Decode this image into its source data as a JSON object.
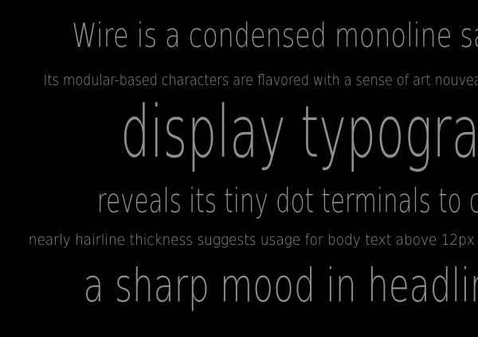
{
  "specimen": {
    "lines": [
      "Wire is a condensed monoline sans",
      "Its modular-based characters are flavored with a sense of art nouveau",
      "display typography",
      "reveals its tiny dot terminals to create",
      "nearly hairline thickness suggests usage for body text above 12px",
      "a sharp mood in headlines"
    ],
    "colors": {
      "background": "#000000",
      "text": "#8f8f8f"
    }
  }
}
